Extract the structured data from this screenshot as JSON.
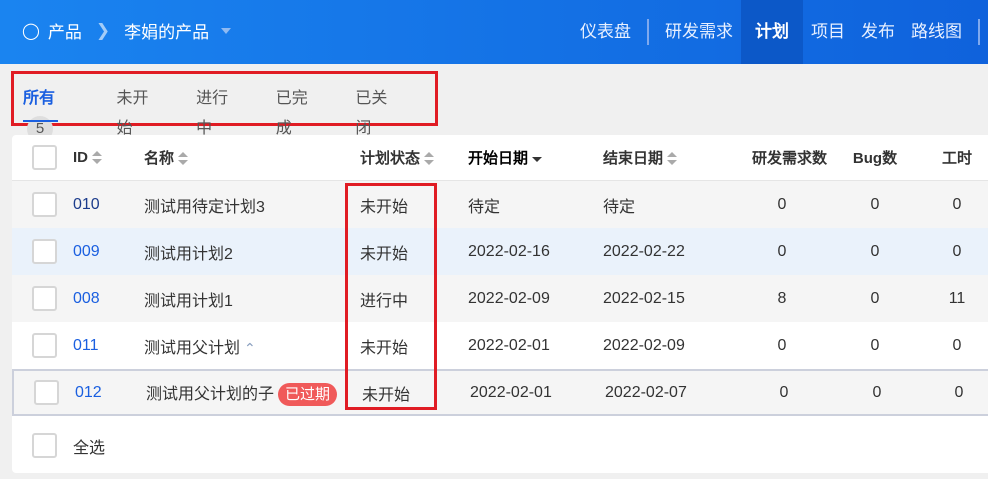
{
  "header": {
    "breadcrumb_root": "产品",
    "breadcrumb_current": "李娟的产品",
    "nav": [
      "仪表盘",
      "研发需求",
      "计划",
      "项目",
      "发布",
      "路线图"
    ],
    "active_nav": "计划"
  },
  "tabs": [
    {
      "label": "所有",
      "count": "5"
    },
    {
      "label": "未开始"
    },
    {
      "label": "进行中"
    },
    {
      "label": "已完成"
    },
    {
      "label": "已关闭"
    }
  ],
  "table": {
    "columns": [
      "ID",
      "名称",
      "计划状态",
      "开始日期",
      "结束日期",
      "研发需求数",
      "Bug数",
      "工时"
    ],
    "rows": [
      {
        "id": "010",
        "name": "测试用待定计划3",
        "status": "未开始",
        "start": "待定",
        "end": "待定",
        "stories": "0",
        "bugs": "0",
        "hours": "0"
      },
      {
        "id": "009",
        "name": "测试用计划2",
        "status": "未开始",
        "start": "2022-02-16",
        "end": "2022-02-22",
        "stories": "0",
        "bugs": "0",
        "hours": "0"
      },
      {
        "id": "008",
        "name": "测试用计划1",
        "status": "进行中",
        "start": "2022-02-09",
        "end": "2022-02-15",
        "stories": "8",
        "bugs": "0",
        "hours": "11"
      },
      {
        "id": "011",
        "name": "测试用父计划",
        "status": "未开始",
        "start": "2022-02-01",
        "end": "2022-02-09",
        "stories": "0",
        "bugs": "0",
        "hours": "0"
      },
      {
        "id": "012",
        "name": "测试用父计划的子",
        "badge": "已过期",
        "status": "未开始",
        "start": "2022-02-01",
        "end": "2022-02-07",
        "stories": "0",
        "bugs": "0",
        "hours": "0"
      }
    ],
    "select_all": "全选"
  }
}
